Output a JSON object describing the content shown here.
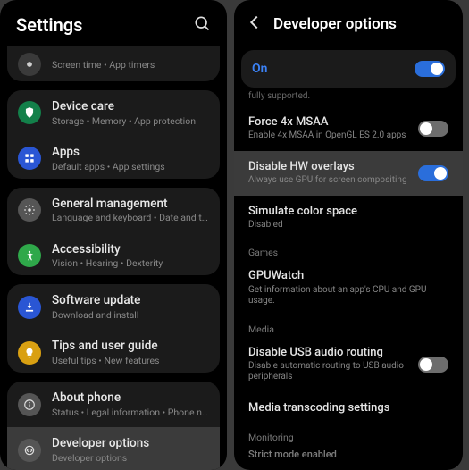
{
  "left": {
    "title": "Settings",
    "partial": {
      "sub": "Screen time  •  App timers"
    },
    "g1": [
      {
        "iconBg": "#13804a",
        "icon": "device-care",
        "title": "Device care",
        "sub": "Storage  •  Memory  •  App protection"
      },
      {
        "iconBg": "#2a56d4",
        "icon": "apps",
        "title": "Apps",
        "sub": "Default apps  •  App settings"
      }
    ],
    "g2": [
      {
        "iconBg": "#555555",
        "icon": "general",
        "title": "General management",
        "sub": "Language and keyboard  •  Date and time"
      },
      {
        "iconBg": "#2fa84a",
        "icon": "accessibility",
        "title": "Accessibility",
        "sub": "Vision  •  Hearing  •  Dexterity"
      }
    ],
    "g3": [
      {
        "iconBg": "#2a56d4",
        "icon": "software-update",
        "title": "Software update",
        "sub": "Download and install"
      },
      {
        "iconBg": "#d9a012",
        "icon": "tips",
        "title": "Tips and user guide",
        "sub": "Useful tips  •  New features"
      }
    ],
    "g4": [
      {
        "iconBg": "#555555",
        "icon": "about",
        "title": "About phone",
        "sub": "Status  •  Legal information  •  Phone name"
      },
      {
        "iconBg": "#555555",
        "icon": "dev",
        "title": "Developer options",
        "sub": "Developer options",
        "selected": true
      }
    ]
  },
  "right": {
    "title": "Developer options",
    "master": {
      "label": "On",
      "state": "on"
    },
    "cutText": "fully supported.",
    "rows1": [
      {
        "title": "Force 4x MSAA",
        "sub": "Enable 4x MSAA in OpenGL ES 2.0 apps",
        "toggle": "off"
      },
      {
        "title": "Disable HW overlays",
        "sub": "Always use GPU for screen compositing",
        "toggle": "on",
        "selected": true
      },
      {
        "title": "Simulate color space",
        "sub": "Disabled"
      }
    ],
    "section1": "Games",
    "rows2": [
      {
        "title": "GPUWatch",
        "sub": "Get information about an app's CPU and GPU usage."
      }
    ],
    "section2": "Media",
    "rows3": [
      {
        "title": "Disable USB audio routing",
        "sub": "Disable automatic routing to USB audio peripherals",
        "toggle": "off"
      },
      {
        "title": "Media transcoding settings"
      }
    ],
    "section3": "Monitoring",
    "rows4": [
      {
        "title": "Strict mode enabled"
      }
    ]
  }
}
